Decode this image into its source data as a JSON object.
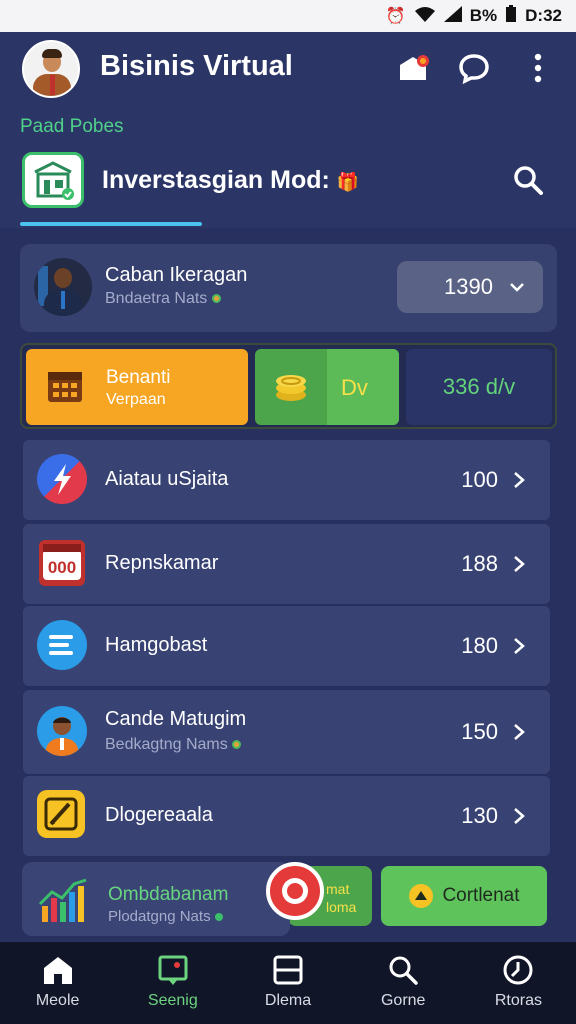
{
  "status_bar": {
    "battery": "B%",
    "time": "D:32"
  },
  "header": {
    "title": "Bisinis Virtual",
    "subtitle": "Paad Pobes",
    "tab_label": "Inverstasgian Mod:",
    "icons": {
      "notification": "notification-icon",
      "chat": "chat-bubble-icon",
      "more": "more-vertical-icon",
      "search": "search-icon"
    }
  },
  "featured": {
    "title": "Caban Ikeragan",
    "subtitle": "Bndaetra Nats",
    "value": "1390"
  },
  "actions": {
    "orange_title": "Benanti",
    "orange_sub": "Verpaan",
    "green_label": "Dv",
    "dark_label": "336 d/v"
  },
  "list": [
    {
      "label": "Aiatau uSjaita",
      "sublabel": "",
      "value": "100",
      "icon": "lightning-icon",
      "color": "#e23a4a"
    },
    {
      "label": "Repnskamar",
      "sublabel": "",
      "value": "188",
      "icon": "counter-icon",
      "color": "#c0302c"
    },
    {
      "label": "Hamgobast",
      "sublabel": "",
      "value": "180",
      "icon": "menu-lines-icon",
      "color": "#2a9ce8"
    },
    {
      "label": "Cande Matugim",
      "sublabel": "Bedkagtng Nams",
      "value": "150",
      "icon": "person-avatar-icon",
      "color": "#2a9ce8"
    },
    {
      "label": "Dlogereaala",
      "sublabel": "",
      "value": "130",
      "icon": "edit-note-icon",
      "color": "#f6c224"
    }
  ],
  "promo": {
    "title": "Ombdabanam",
    "subtitle": "Plodatgng Nats",
    "mid_text_1": "mat",
    "mid_text_2": "loma",
    "right_button": "Cortlenat"
  },
  "nav": [
    {
      "label": "Meole",
      "icon": "home-icon",
      "active": false
    },
    {
      "label": "Seenig",
      "icon": "tag-icon",
      "active": true
    },
    {
      "label": "Dlema",
      "icon": "square-icon",
      "active": false
    },
    {
      "label": "Gorne",
      "icon": "search-icon",
      "active": false
    },
    {
      "label": "Rtoras",
      "icon": "clock-icon",
      "active": false
    }
  ]
}
